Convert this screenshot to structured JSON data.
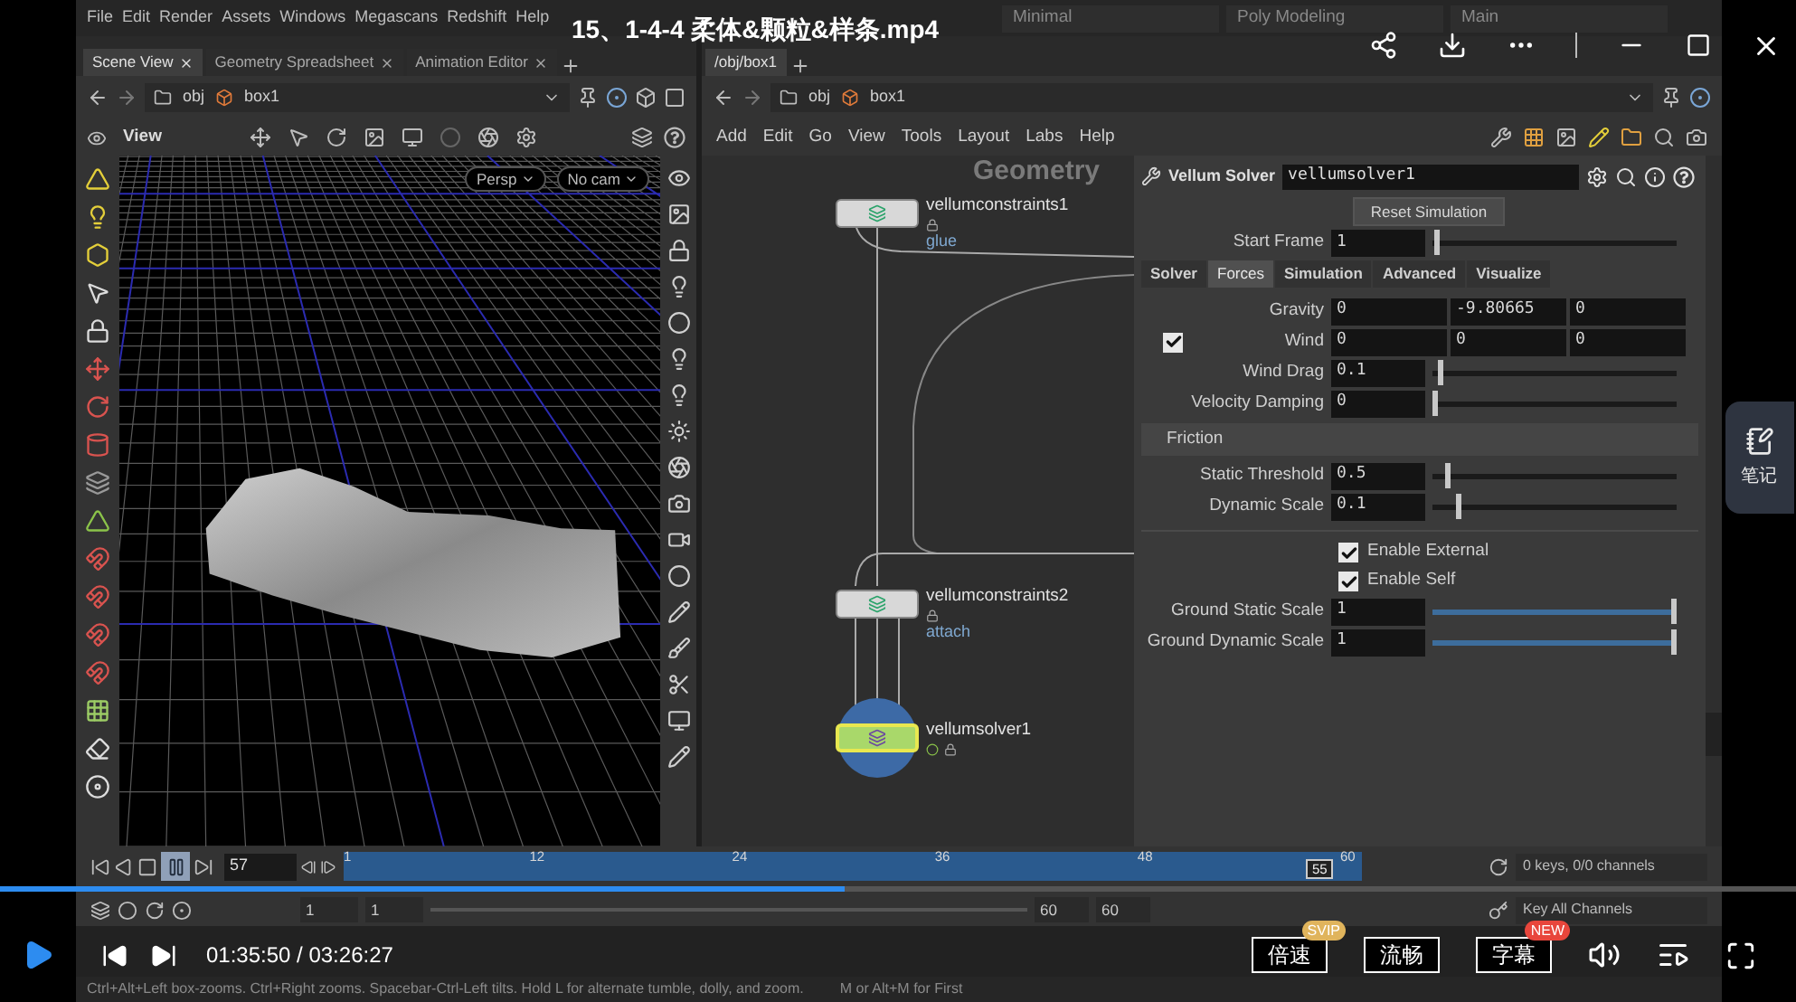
{
  "player": {
    "title": "15、1-4-4 柔体&颗粒&样条.mp4",
    "time": "01:35:50 / 03:26:27",
    "progress": {
      "level": 0.47
    },
    "options": [
      {
        "label": "倍速",
        "badge": {
          "text": "SVIP",
          "color": "#e0b45c"
        }
      },
      {
        "label": "流畅"
      },
      {
        "label": "字幕",
        "badge": {
          "text": "NEW",
          "color": "#e8463c"
        }
      }
    ],
    "notes": "笔记"
  },
  "houdini": {
    "menu": [
      "File",
      "Edit",
      "Render",
      "Assets",
      "Windows",
      "Megascans",
      "Redshift",
      "Help"
    ],
    "desktops": [
      "Minimal",
      "Poly Modeling",
      "Main"
    ],
    "scene_tabs": [
      {
        "label": "Scene View",
        "selected": true
      },
      {
        "label": "Geometry Spreadsheet",
        "selected": false
      },
      {
        "label": "Animation Editor",
        "selected": false
      }
    ],
    "network_tabs": [
      {
        "label": "/obj/box1",
        "selected": true
      }
    ],
    "scene_path": [
      "obj",
      "box1"
    ],
    "network_path": [
      "obj",
      "box1"
    ],
    "viewport": {
      "title": "View",
      "menus": [
        "Persp",
        "No cam"
      ]
    },
    "network_menu": [
      "Add",
      "Edit",
      "Go",
      "View",
      "Tools",
      "Layout",
      "Labs",
      "Help"
    ],
    "network_context": "Geometry",
    "nodes": [
      {
        "kind": "constraint",
        "name": "vellumconstraints1",
        "comment": "glue",
        "selected": false
      },
      {
        "kind": "constraint",
        "name": "vellumconstraints2",
        "comment": "attach",
        "selected": false
      },
      {
        "kind": "solver",
        "name": "vellumsolver1",
        "selected": true
      }
    ],
    "parameters": {
      "type": "Vellum Solver",
      "node_name": "vellumsolver1",
      "reset": "Reset Simulation",
      "start_frame": {
        "label": "Start Frame",
        "value": "1",
        "level": 0.01
      },
      "tabs": [
        {
          "label": "Solver",
          "selected": false
        },
        {
          "label": "Forces",
          "selected": true
        },
        {
          "label": "Simulation",
          "selected": false
        },
        {
          "label": "Advanced",
          "selected": false
        },
        {
          "label": "Visualize",
          "selected": false
        }
      ],
      "rows": [
        {
          "kind": "vector",
          "label": "Gravity",
          "values": [
            "0",
            "-9.80665",
            "0"
          ]
        },
        {
          "kind": "vector",
          "label": "Wind",
          "values": [
            "0",
            "0",
            "0"
          ],
          "checked": true
        },
        {
          "kind": "slider",
          "label": "Wind Drag",
          "value": "0.1",
          "level": 0.02
        },
        {
          "kind": "slider",
          "label": "Velocity Damping",
          "value": "0",
          "level": 0
        },
        {
          "kind": "section",
          "label": "Friction"
        },
        {
          "kind": "slider",
          "label": "Static Threshold",
          "value": "0.5",
          "level": 0.05
        },
        {
          "kind": "slider",
          "label": "Dynamic Scale",
          "value": "0.1",
          "level": 0.1
        },
        {
          "kind": "divider"
        },
        {
          "kind": "checkbox",
          "label": "Enable External",
          "checked": true
        },
        {
          "kind": "checkbox",
          "label": "Enable Self",
          "checked": true
        },
        {
          "kind": "ramp",
          "label": "Ground Static Scale",
          "value": "1",
          "level": 1
        },
        {
          "kind": "ramp",
          "label": "Ground Dynamic Scale",
          "value": "1",
          "level": 1
        }
      ]
    },
    "timeline": {
      "playing": true,
      "frame": "57",
      "ticks": [
        "1",
        "12",
        "24",
        "36",
        "48",
        "60"
      ],
      "current": "55",
      "level": 0.96,
      "keys_info": "0 keys, 0/0 channels",
      "start_fields": [
        "1",
        "1"
      ],
      "end_fields": [
        "60",
        "60"
      ],
      "key_all": "Key All Channels"
    },
    "status": [
      "Ctrl+Alt+Left box-zooms. Ctrl+Right zooms. Spacebar-Ctrl-Left tilts. Hold L for alternate tumble, dolly, and zoom.",
      "M or Alt+M for First"
    ]
  }
}
